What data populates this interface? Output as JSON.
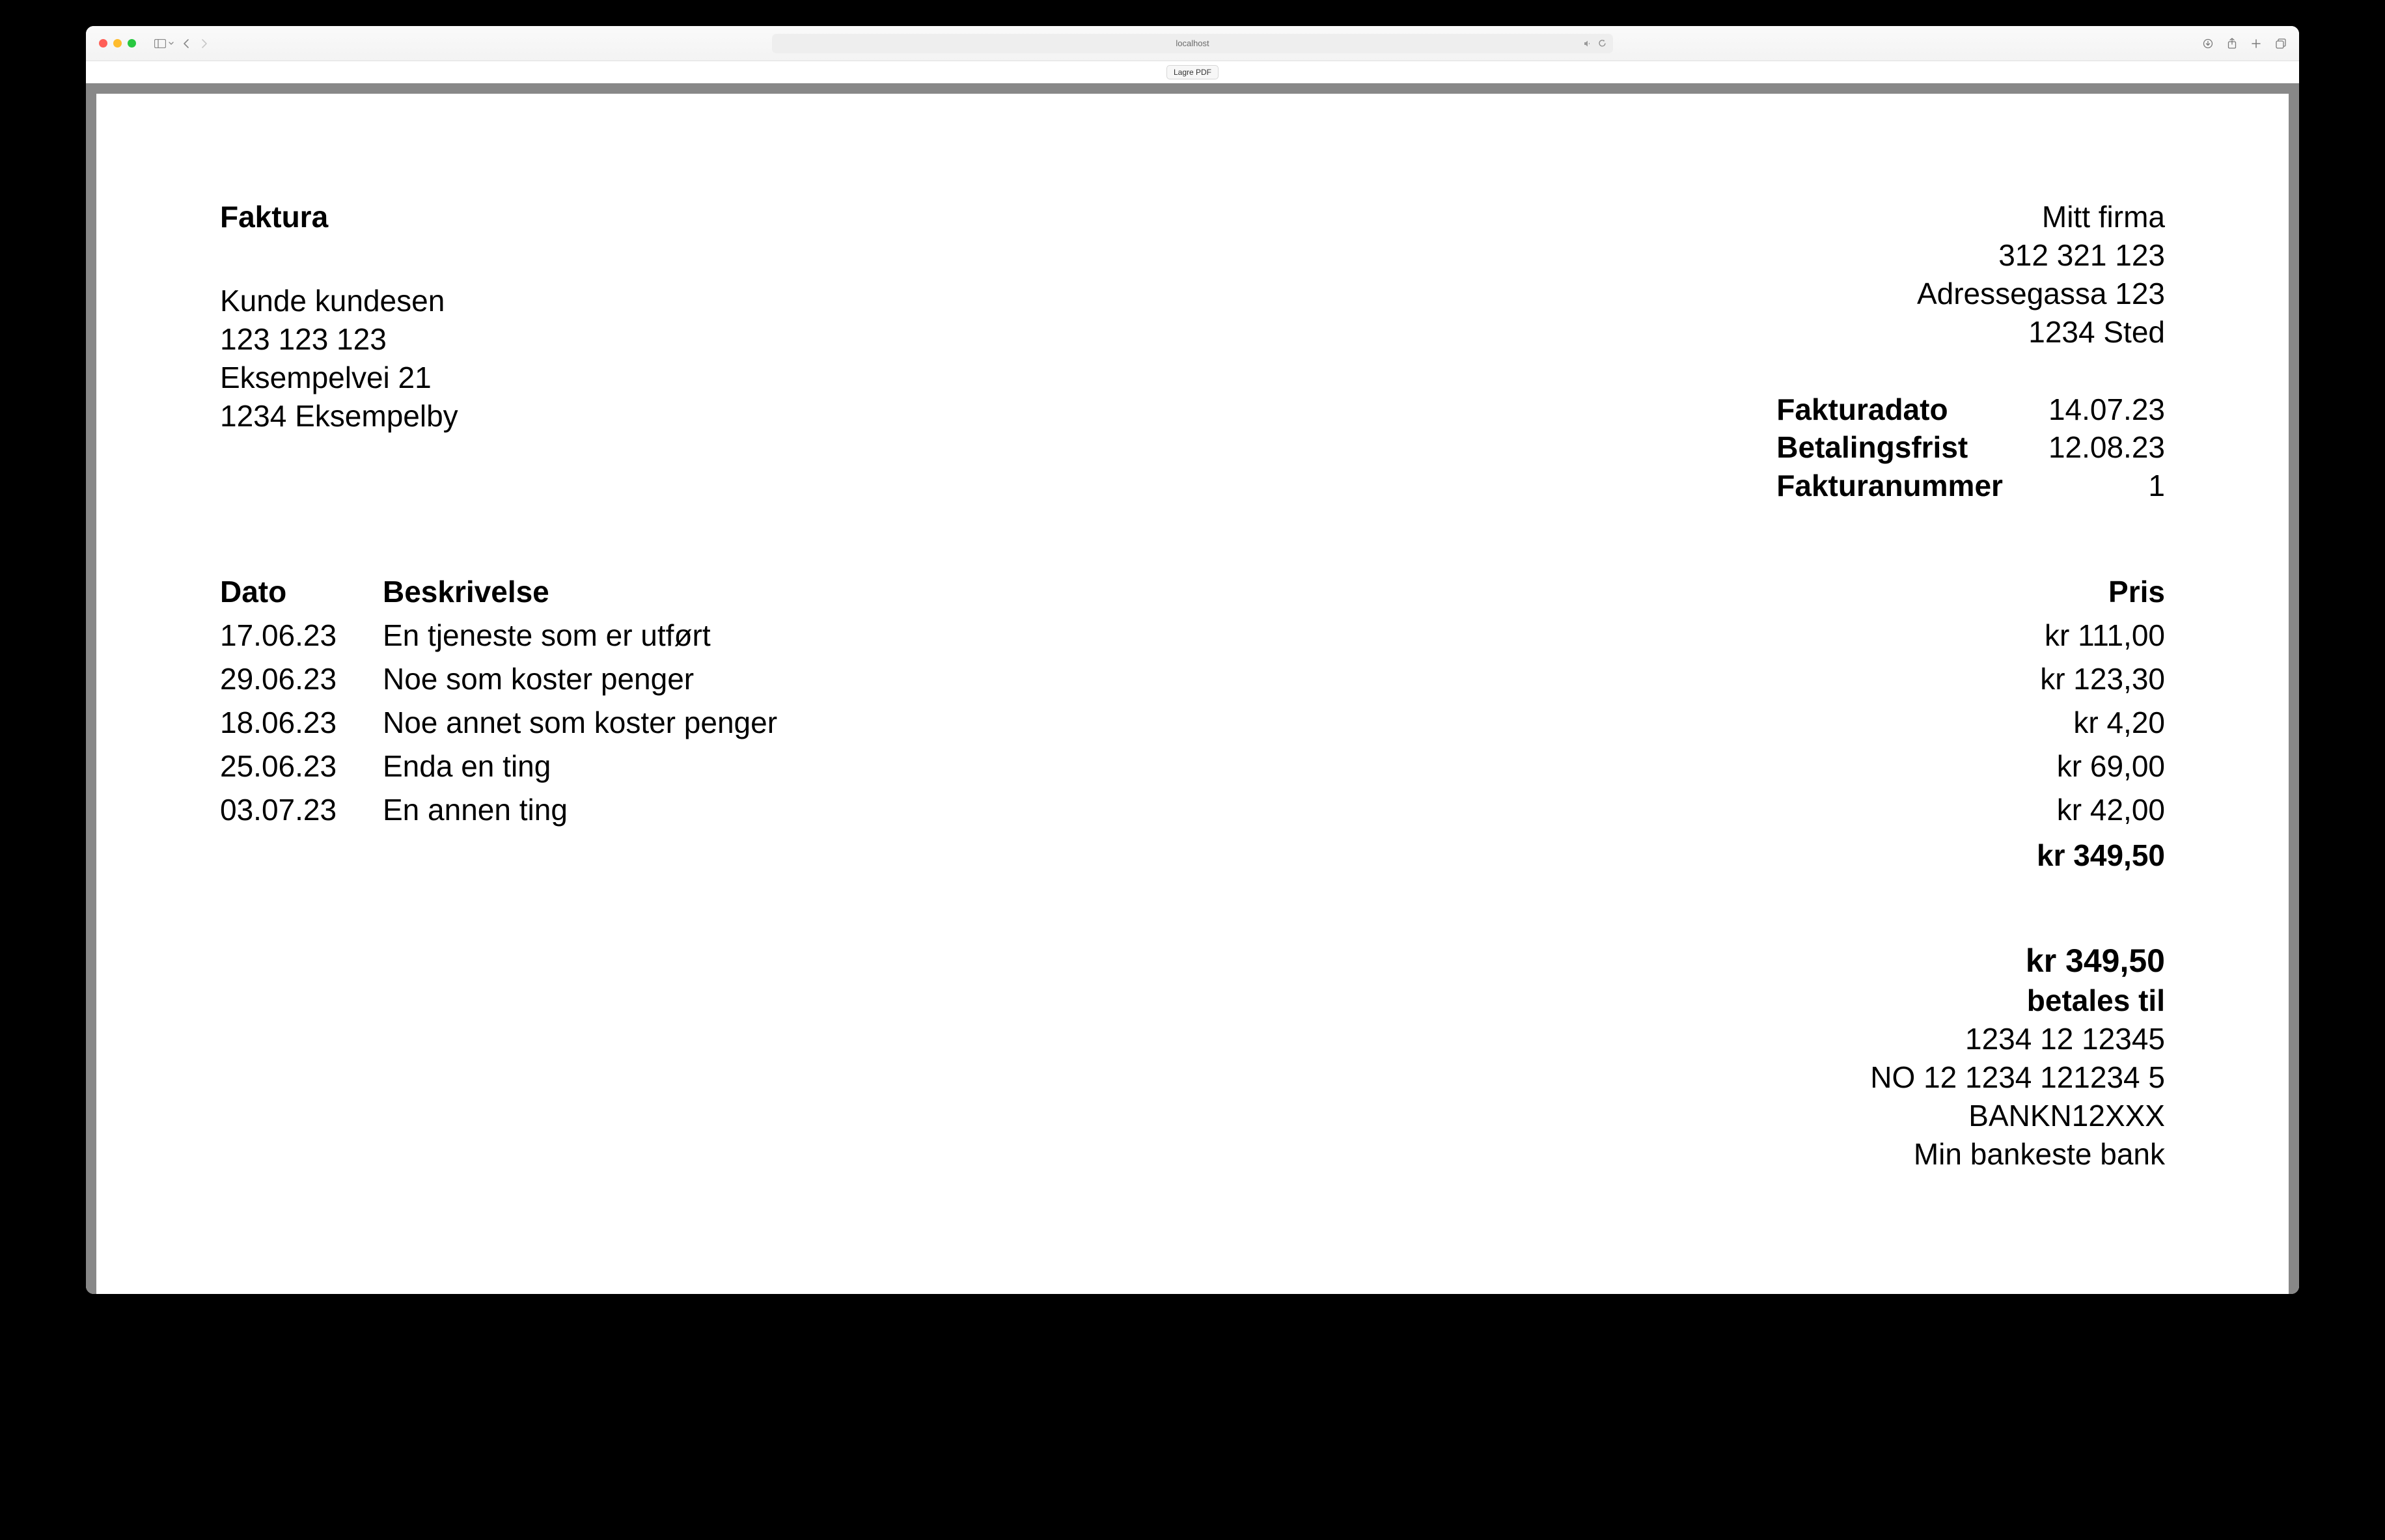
{
  "browser": {
    "address": "localhost"
  },
  "toolbar": {
    "save_pdf_label": "Lagre PDF"
  },
  "invoice": {
    "title": "Faktura",
    "sender": {
      "name": "Mitt firma",
      "orgnr": "312 321 123",
      "street": "Adressegassa 123",
      "city": "1234 Sted"
    },
    "customer": {
      "name": "Kunde kundesen",
      "id": "123 123 123",
      "street": "Eksempelvei 21",
      "city": "1234 Eksempelby"
    },
    "meta": {
      "date_label": "Fakturadato",
      "date_value": "14.07.23",
      "due_label": "Betalingsfrist",
      "due_value": "12.08.23",
      "number_label": "Fakturanummer",
      "number_value": "1"
    },
    "columns": {
      "date": "Dato",
      "description": "Beskrivelse",
      "price": "Pris"
    },
    "items": [
      {
        "date": "17.06.23",
        "description": "En tjeneste som er utført",
        "price": "kr 111,00"
      },
      {
        "date": "29.06.23",
        "description": "Noe som koster penger",
        "price": "kr 123,30"
      },
      {
        "date": "18.06.23",
        "description": "Noe annet som koster penger",
        "price": "kr 4,20"
      },
      {
        "date": "25.06.23",
        "description": "Enda en ting",
        "price": "kr 69,00"
      },
      {
        "date": "03.07.23",
        "description": "En annen ting",
        "price": "kr 42,00"
      }
    ],
    "subtotal": "kr 349,50",
    "payment": {
      "total": "kr 349,50",
      "pay_to_label": "betales til",
      "account": "1234 12 12345",
      "iban": "NO 12 1234 121234 5",
      "bic": "BANKN12XXX",
      "bank_name": "Min bankeste bank"
    }
  }
}
